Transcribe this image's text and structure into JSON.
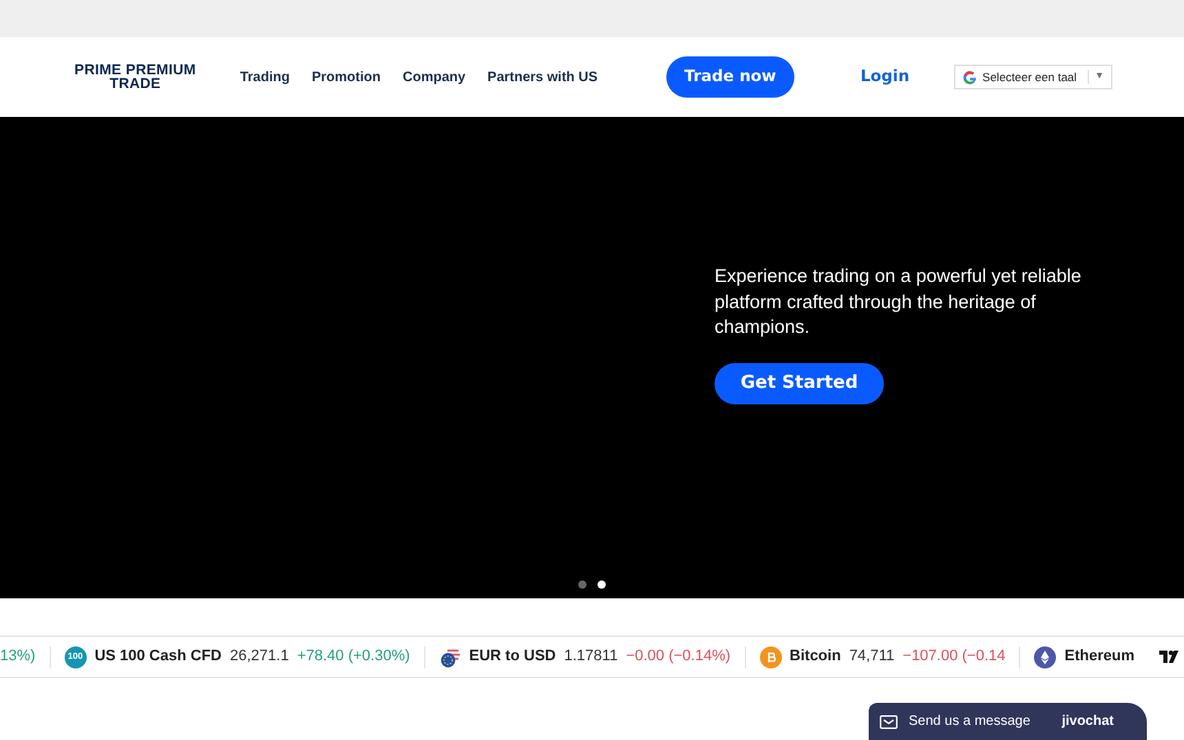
{
  "header": {
    "logo": [
      "PRIME PREMIUM",
      "TRADE"
    ],
    "nav": [
      "Trading",
      "Promotion",
      "Company",
      "Partners with US"
    ],
    "cta": "Trade now",
    "login": "Login",
    "language": {
      "label": "Selecteer een taal",
      "arrow": "▼"
    }
  },
  "hero": {
    "text": "Experience trading on a powerful yet reliable platform crafted through the heritage of champions.",
    "button": "Get Started",
    "dots": [
      {
        "selected": false
      },
      {
        "selected": true
      }
    ]
  },
  "ticker": [
    {
      "kind": "partial",
      "change": "13%)",
      "color": "#22a376"
    },
    {
      "kind": "index",
      "icon_text": "100",
      "name": "US 100 Cash CFD",
      "price": "26,271.1",
      "change": "+78.40 (+0.30%)",
      "color": "#22a376"
    },
    {
      "kind": "flags",
      "name": "EUR to USD",
      "price": "1.17811",
      "change": "−0.00 (−0.14%)",
      "color": "#e0505b"
    },
    {
      "kind": "bitcoin",
      "name": "Bitcoin",
      "price": "74,711",
      "change": "−107.00 (−0.14",
      "color": "#e0505b"
    },
    {
      "kind": "ethereum",
      "name": "Ethereum"
    }
  ],
  "chat": {
    "label": "Send us a message",
    "brand": "jivochat"
  }
}
